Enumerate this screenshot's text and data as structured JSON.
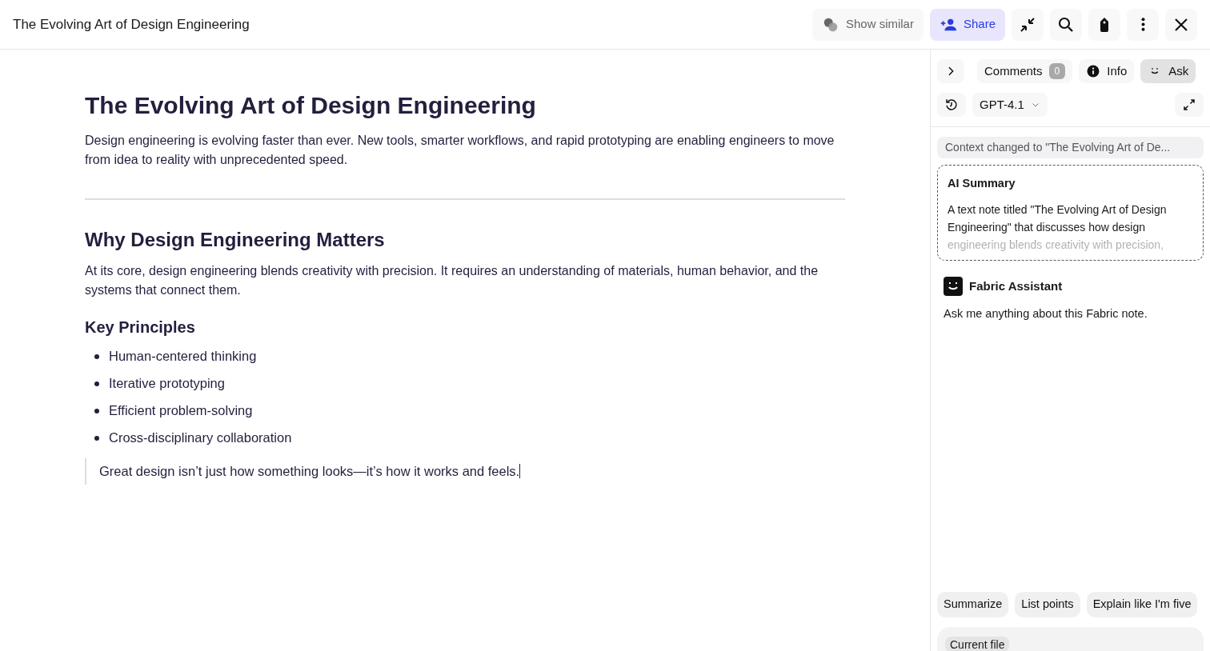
{
  "window": {
    "title": "The Evolving Art of Design Engineering"
  },
  "toolbar": {
    "show_similar": "Show similar",
    "share": "Share"
  },
  "document": {
    "title": "The Evolving Art of Design Engineering",
    "intro": "Design engineering is evolving faster than ever. New tools, smarter workflows, and rapid prototyping are enabling engineers to move from idea to reality with unprecedented speed.",
    "section_heading": "Why Design Engineering Matters",
    "section_text": "At its core, design engineering blends creativity with precision. It requires an understanding of materials, human behavior, and the systems that connect them.",
    "subheading": "Key Principles",
    "bullets": [
      "Human-centered thinking",
      "Iterative prototyping",
      "Efficient problem-solving",
      "Cross-disciplinary collaboration"
    ],
    "quote": "Great design isn’t just how something looks—it’s how it works and feels."
  },
  "panel": {
    "tabs": [
      {
        "label": "Comments",
        "kind": "comments",
        "count": "0",
        "selected": false
      },
      {
        "label": "Info",
        "kind": "info",
        "selected": false
      },
      {
        "label": "Ask",
        "kind": "ask",
        "selected": true
      }
    ],
    "model": "GPT-4.1",
    "context_notice": "Context changed to \"The Evolving Art of De...",
    "summary": {
      "title": "AI Summary",
      "text": "A text note titled \"The Evolving Art of Design Engineering\" that discusses how design engineering blends creativity with precision,"
    },
    "assistant": {
      "name": "Fabric Assistant",
      "message": "Ask me anything about this Fabric note."
    },
    "suggestions": [
      "Summarize",
      "List points",
      "Explain like I'm five"
    ],
    "context_chip": "Current file"
  }
}
